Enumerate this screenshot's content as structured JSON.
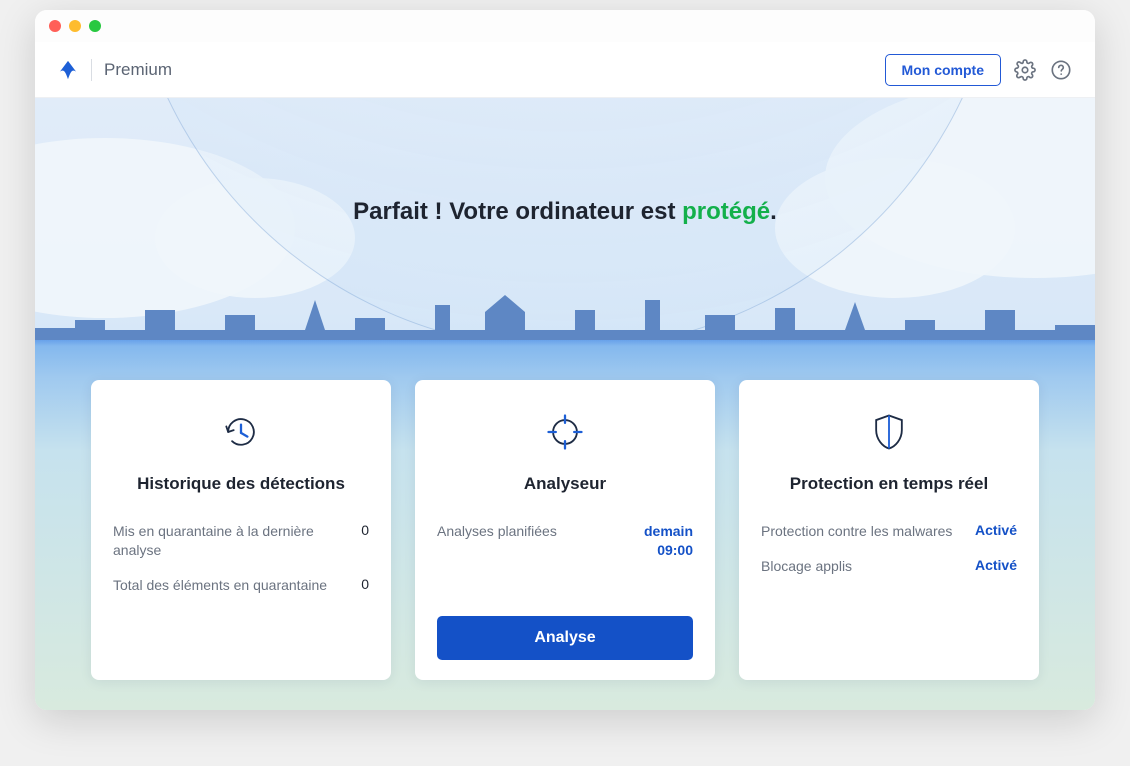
{
  "header": {
    "product_name": "Premium",
    "account_button": "Mon compte"
  },
  "status": {
    "prefix": "Parfait ! Votre ordinateur est ",
    "highlight": "protégé",
    "suffix": "."
  },
  "cards": {
    "history": {
      "title": "Historique des détections",
      "rows": [
        {
          "label": "Mis en quarantaine à la dernière analyse",
          "value": "0"
        },
        {
          "label": "Total des éléments en quarantaine",
          "value": "0"
        }
      ]
    },
    "scanner": {
      "title": "Analyseur",
      "scheduled_label": "Analyses planifiées",
      "scheduled_value_line1": "demain",
      "scheduled_value_line2": "09:00",
      "scan_button": "Analyse"
    },
    "protection": {
      "title": "Protection en temps réel",
      "rows": [
        {
          "label": "Protection contre les malwares",
          "value": "Activé"
        },
        {
          "label": "Blocage applis",
          "value": "Activé"
        }
      ]
    }
  }
}
